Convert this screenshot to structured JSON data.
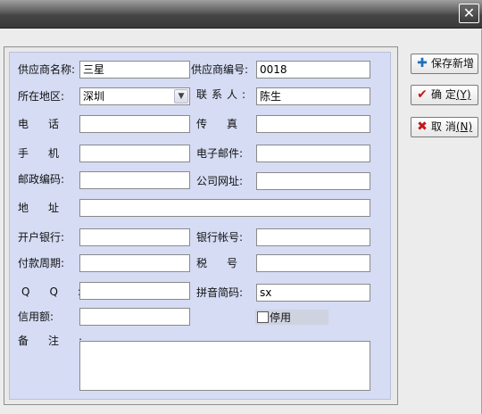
{
  "window": {
    "close_glyph": "✕"
  },
  "form": {
    "supplier_name_label": "供应商名称:",
    "supplier_name_value": "三星",
    "supplier_code_label": "供应商编号:",
    "supplier_code_value": "0018",
    "region_label": "所在地区:",
    "region_value": "深圳",
    "contact_label": "联系人:",
    "contact_value": "陈生",
    "phone_label": "电话:",
    "phone_value": "",
    "fax_label": "传真:",
    "fax_value": "",
    "mobile_label": "手机:",
    "mobile_value": "",
    "email_label": "电子邮件:",
    "email_value": "",
    "postcode_label": "邮政编码:",
    "postcode_value": "",
    "website_label": "公司网址:",
    "website_value": "",
    "address_label": "地址:",
    "address_value": "",
    "bank_label": "开户银行:",
    "bank_value": "",
    "bank_account_label": "银行帐号:",
    "bank_account_value": "",
    "payment_term_label": "付款周期:",
    "payment_term_value": "",
    "tax_label": "税号:",
    "tax_value": "",
    "qq_label": "QQ:",
    "qq_value": "",
    "pinyin_label": "拼音简码:",
    "pinyin_value": "sx",
    "credit_label": "信用额:",
    "credit_value": "",
    "disabled_label": "停用",
    "disabled_checked": false,
    "remarks_label": "备注:",
    "remarks_value": ""
  },
  "buttons": {
    "save_new_label": "保存新增",
    "ok_label": "确 定",
    "ok_hotkey": "(Y)",
    "cancel_label": "取 消",
    "cancel_hotkey": "(N)"
  },
  "icons": {
    "save_new": "plus-icon",
    "ok": "check-icon",
    "cancel": "x-icon"
  }
}
